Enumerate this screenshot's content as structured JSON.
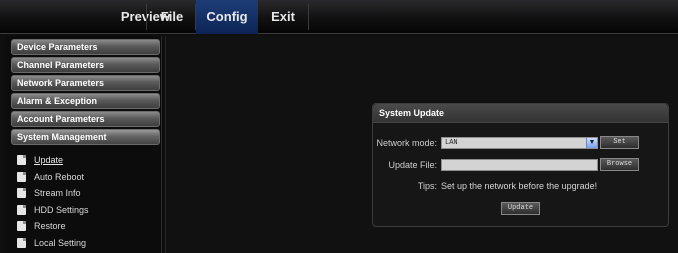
{
  "topbar": {
    "tabs": [
      "Preview",
      "File",
      "Config",
      "Exit"
    ],
    "active_tab": "Config",
    "active_color": "#1e3d78"
  },
  "sidebar": {
    "categories": [
      "Device Parameters",
      "Channel Parameters",
      "Network Parameters",
      "Alarm & Exception",
      "Account Parameters",
      "System Management"
    ],
    "submenu": [
      "Update",
      "Auto Reboot",
      "Stream Info",
      "HDD Settings",
      "Restore",
      "Local Setting"
    ],
    "active_item": "Update",
    "item_icon": "document-icon"
  },
  "panel": {
    "title": "System Update",
    "network_mode_label": "Network mode:",
    "network_mode_value": "LAN",
    "set_button": "Set",
    "update_file_label": "Update File:",
    "update_file_value": "",
    "browse_button": "Browse",
    "tips_label": "Tips:",
    "tips_text": "Set up the network before the upgrade!",
    "update_button": "Update"
  }
}
